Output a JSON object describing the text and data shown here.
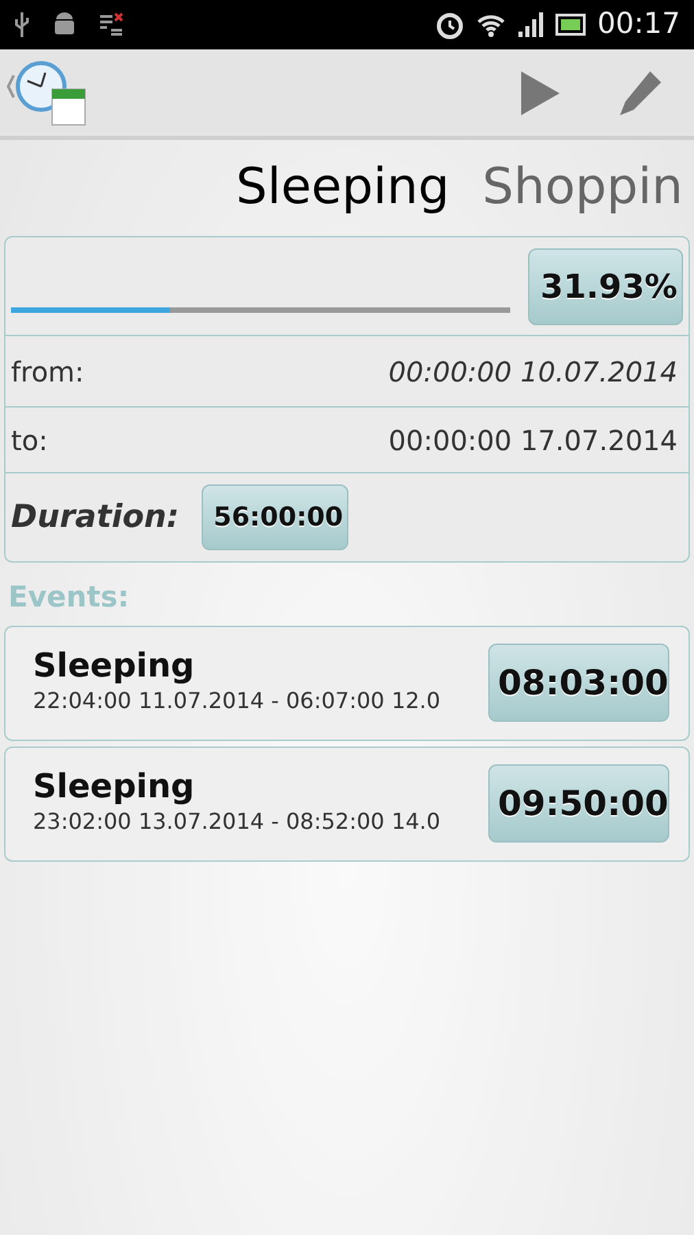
{
  "status_bar": {
    "time": "00:17"
  },
  "tabs": [
    {
      "label": "Sleeping",
      "selected": true
    },
    {
      "label": "Shoppin",
      "selected": false
    }
  ],
  "summary": {
    "progress": {
      "level": 0.32,
      "reading": "31.93%"
    },
    "rows": [
      {
        "label": "from:",
        "value": "00:00:00 10.07.2014",
        "italic": true
      },
      {
        "label": "to:",
        "value": "00:00:00 17.07.2014",
        "italic": false
      }
    ],
    "duration": {
      "label": "Duration:",
      "value": "56:00:00"
    }
  },
  "events_heading": "Events:",
  "events": [
    {
      "title": "Sleeping",
      "range": "22:04:00 11.07.2014 - 06:07:00 12.0",
      "duration": "08:03:00"
    },
    {
      "title": "Sleeping",
      "range": "23:02:00 13.07.2014 - 08:52:00 14.0",
      "duration": "09:50:00"
    }
  ]
}
